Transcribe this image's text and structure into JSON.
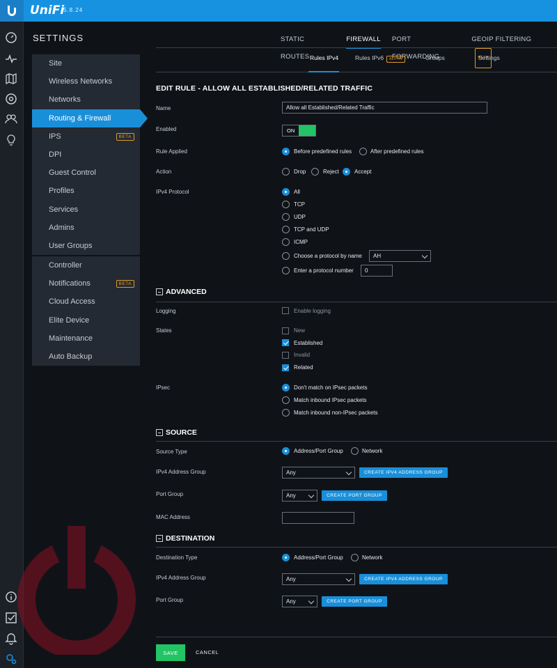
{
  "app": {
    "brand": "UniFi",
    "version": "5.8.24"
  },
  "leftnav": [
    "dashboard-icon",
    "statistics-icon",
    "map-icon",
    "devices-icon",
    "clients-icon",
    "insights-icon",
    "info-icon",
    "tasks-icon",
    "alerts-icon",
    "settings-icon"
  ],
  "sidebar": {
    "title": "SETTINGS",
    "group1": [
      {
        "label": "Site"
      },
      {
        "label": "Wireless Networks"
      },
      {
        "label": "Networks"
      },
      {
        "label": "Routing & Firewall",
        "active": true
      },
      {
        "label": "IPS",
        "badge": "BETA"
      },
      {
        "label": "DPI"
      },
      {
        "label": "Guest Control"
      },
      {
        "label": "Profiles"
      },
      {
        "label": "Services"
      },
      {
        "label": "Admins"
      },
      {
        "label": "User Groups"
      }
    ],
    "group2": [
      {
        "label": "Controller"
      },
      {
        "label": "Notifications",
        "badge": "BETA"
      },
      {
        "label": "Cloud Access"
      },
      {
        "label": "Elite Device"
      },
      {
        "label": "Maintenance"
      },
      {
        "label": "Auto Backup"
      }
    ]
  },
  "tabs": [
    {
      "label": "STATIC ROUTES"
    },
    {
      "label": "FIREWALL",
      "active": true
    },
    {
      "label": "PORT FORWARDING"
    },
    {
      "label": "GEOIP FILTERING",
      "badge": "BETA"
    }
  ],
  "subtabs": [
    {
      "label": "Rules IPv4",
      "active": true
    },
    {
      "label": "Rules IPv6",
      "badge": "ALPHA"
    },
    {
      "label": "Groups"
    },
    {
      "label": "Settings"
    }
  ],
  "form": {
    "title": "EDIT RULE - ALLOW ALL ESTABLISHED/RELATED TRAFFIC",
    "name_label": "Name",
    "name_value": "Allow all Established/Related Traffic",
    "enabled_label": "Enabled",
    "toggle_text": "ON",
    "rule_applied_label": "Rule Applied",
    "rule_applied_options": [
      "Before predefined rules",
      "After predefined rules"
    ],
    "action_label": "Action",
    "action_options": [
      "Drop",
      "Reject",
      "Accept"
    ],
    "protocol_label": "IPv4 Protocol",
    "protocol_options": [
      "All",
      "TCP",
      "UDP",
      "TCP and UDP",
      "ICMP",
      "Choose a protocol by name",
      "Enter a protocol number"
    ],
    "protocol_name_value": "AH",
    "protocol_number_value": "0"
  },
  "advanced": {
    "title": "ADVANCED",
    "logging_label": "Logging",
    "logging_option": "Enable logging",
    "states_label": "States",
    "states": [
      {
        "label": "New",
        "checked": false
      },
      {
        "label": "Established",
        "checked": true
      },
      {
        "label": "Invalid",
        "checked": false
      },
      {
        "label": "Related",
        "checked": true
      }
    ],
    "ipsec_label": "IPsec",
    "ipsec_options": [
      "Don't match on IPsec packets",
      "Match inbound IPsec packets",
      "Match inbound non-IPsec packets"
    ]
  },
  "source": {
    "title": "SOURCE",
    "type_label": "Source Type",
    "type_options": [
      "Address/Port Group",
      "Network"
    ],
    "addr_label": "IPv4 Address Group",
    "addr_value": "Any",
    "addr_button": "CREATE IPV4 ADDRESS GROUP",
    "port_label": "Port Group",
    "port_value": "Any",
    "port_button": "CREATE PORT GROUP",
    "mac_label": "MAC Address"
  },
  "destination": {
    "title": "DESTINATION",
    "type_label": "Destination Type",
    "type_options": [
      "Address/Port Group",
      "Network"
    ],
    "addr_label": "IPv4 Address Group",
    "addr_value": "Any",
    "addr_button": "CREATE IPV4 ADDRESS GROUP",
    "port_label": "Port Group",
    "port_value": "Any",
    "port_button": "CREATE PORT GROUP"
  },
  "footer": {
    "save": "SAVE",
    "cancel": "CANCEL"
  },
  "colors": {
    "accent": "#1a8fd9",
    "success": "#22c465",
    "topbar": "#1792e0",
    "badge": "#e19a28"
  }
}
